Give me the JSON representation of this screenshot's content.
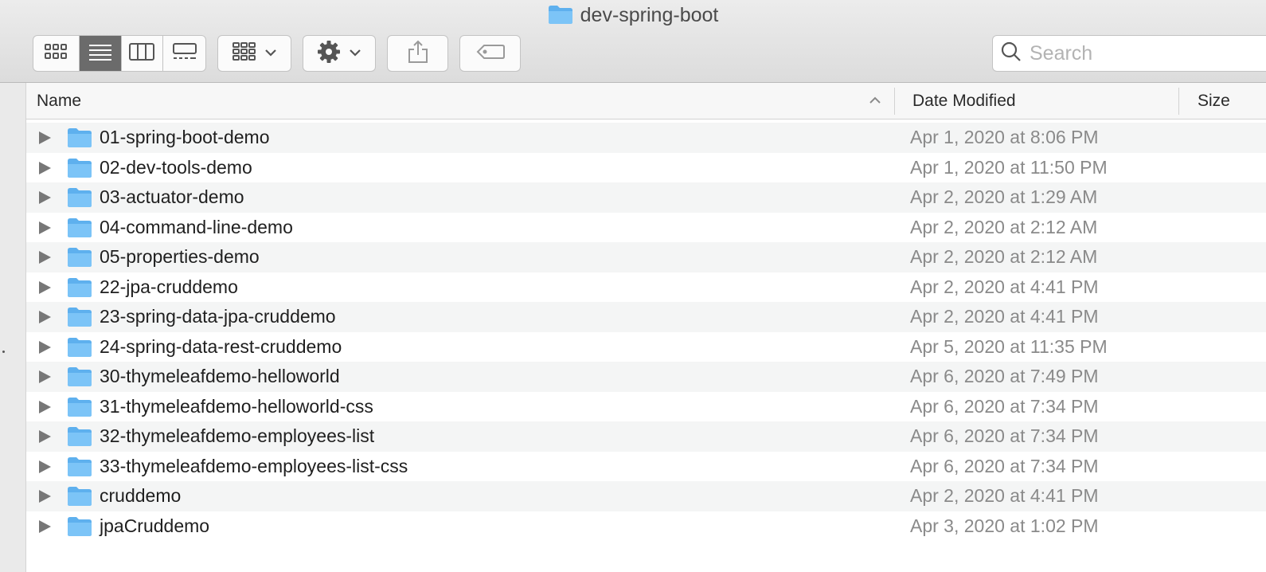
{
  "window": {
    "title": "dev-spring-boot"
  },
  "toolbar": {
    "view_buttons": [
      {
        "name": "icon-view-button",
        "icon": "grid-icon",
        "active": false
      },
      {
        "name": "list-view-button",
        "icon": "list-icon",
        "active": true
      },
      {
        "name": "column-view-button",
        "icon": "columns-icon",
        "active": false
      },
      {
        "name": "gallery-view-button",
        "icon": "gallery-icon",
        "active": false
      }
    ],
    "group_button_icon": "group-icon",
    "action_button_icon": "gear-icon",
    "share_button_icon": "share-icon",
    "tag_button_icon": "tag-icon",
    "search_placeholder": "Search"
  },
  "table": {
    "columns": {
      "name": "Name",
      "date_modified": "Date Modified",
      "size": "Size"
    },
    "sort": {
      "column": "Name",
      "direction": "ascending"
    },
    "rows": [
      {
        "name": "01-spring-boot-demo",
        "date": "Apr 1, 2020 at 8:06 PM"
      },
      {
        "name": "02-dev-tools-demo",
        "date": "Apr 1, 2020 at 11:50 PM"
      },
      {
        "name": "03-actuator-demo",
        "date": "Apr 2, 2020 at 1:29 AM"
      },
      {
        "name": "04-command-line-demo",
        "date": "Apr 2, 2020 at 2:12 AM"
      },
      {
        "name": "05-properties-demo",
        "date": "Apr 2, 2020 at 2:12 AM"
      },
      {
        "name": "22-jpa-cruddemo",
        "date": "Apr 2, 2020 at 4:41 PM"
      },
      {
        "name": "23-spring-data-jpa-cruddemo",
        "date": "Apr 2, 2020 at 4:41 PM"
      },
      {
        "name": "24-spring-data-rest-cruddemo",
        "date": "Apr 5, 2020 at 11:35 PM"
      },
      {
        "name": "30-thymeleafdemo-helloworld",
        "date": "Apr 6, 2020 at 7:49 PM"
      },
      {
        "name": "31-thymeleafdemo-helloworld-css",
        "date": "Apr 6, 2020 at 7:34 PM"
      },
      {
        "name": "32-thymeleafdemo-employees-list",
        "date": "Apr 6, 2020 at 7:34 PM"
      },
      {
        "name": "33-thymeleafdemo-employees-list-css",
        "date": "Apr 6, 2020 at 7:34 PM"
      },
      {
        "name": "cruddemo",
        "date": "Apr 2, 2020 at 4:41 PM"
      },
      {
        "name": "jpaCruddemo",
        "date": "Apr 3, 2020 at 1:02 PM"
      }
    ]
  },
  "colors": {
    "folder": "#79c1f5",
    "folder_tab": "#5eb0ee",
    "selected_view": "#6b6b6b",
    "row_stripe": "#f4f5f5",
    "date_text": "#8a8a8a"
  }
}
